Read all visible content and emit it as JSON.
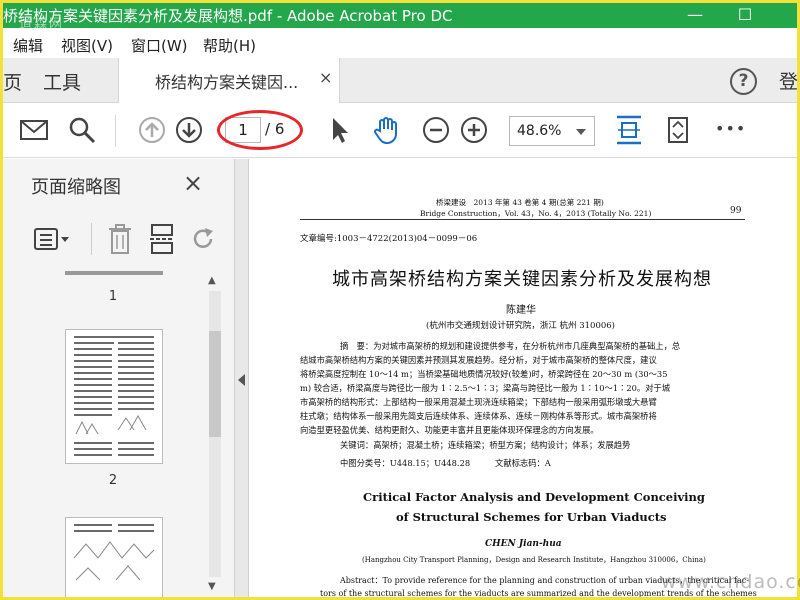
{
  "window": {
    "title": "桥结构方案关键因素分析及发展构想.pdf - Adobe Acrobat Pro DC",
    "watermark_left": "道森网",
    "minimize": "—",
    "maximize": "☐"
  },
  "menu": [
    "编辑",
    "视图(V)",
    "窗口(W)",
    "帮助(H)"
  ],
  "tabs": {
    "home_fragment": "页",
    "tools": "工具",
    "doc_tab": "桥结构方案关键因...",
    "close": "×",
    "help": "?",
    "signin_fragment": "登"
  },
  "toolbar": {
    "page_current": "1",
    "page_total": "/ 6",
    "zoom": "48.6%",
    "more": "•••"
  },
  "colors": {
    "titlebar": "#24a64a",
    "frame": "#f2e13a",
    "accent_blue": "#1a6fc2",
    "highlight_ring": "#e8262a"
  },
  "panel": {
    "title": "页面缩略图",
    "close": "×",
    "thumb_labels": [
      "1",
      "2"
    ]
  },
  "document": {
    "header_line1": "桥梁建设　2013 年第 43 卷第 4 期(总第 221 期)",
    "header_line2": "Bridge Construction，Vol. 43，No. 4，2013 (Totally No. 221)",
    "page_number": "99",
    "article_no": "文章编号:1003－4722(2013)04－0099－06",
    "title_cn": "城市高架桥结构方案关键因素分析及发展构想",
    "author_cn": "陈建华",
    "affiliation_cn": "(杭州市交通规划设计研究院，浙江 杭州 310006)",
    "abstract_lines": [
      "摘　要：为对城市高架桥的规划和建设提供参考，在分析杭州市几座典型高架桥的基础上，总",
      "结城市高架桥结构方案的关键因素并预测其发展趋势。经分析，对于城市高架桥的整体尺度，建议",
      "将桥梁高度控制在 10～14 m；当桥梁基础地质情况较好(较差)时，桥梁跨径在 20～30 m (30～35",
      "m) 较合适，桥梁高度与跨径比一般为 1∶2.5～1∶3；梁高与跨径比一般为 1∶10～1∶20。对于城",
      "市高架桥的结构形式：上部结构一般采用混凝土现浇连续箱梁；下部结构一般采用弧形墩或大悬臂",
      "柱式墩；结构体系一般采用先简支后连续体系、连续体系、连续－刚构体系等形式。城市高架桥将",
      "向造型更轻盈优美、结构更耐久、功能更丰富并且更能体现环保理念的方向发展。"
    ],
    "keywords": "关键词：高架桥；混凝土桥；连续箱梁；桥型方案；结构设计；体系；发展趋势",
    "classification": "中图分类号：U448.15；U448.28　　　文献标志码：A",
    "title_en_line1": "Critical Factor Analysis and Development Conceiving",
    "title_en_line2": "of Structural Schemes for Urban Viaducts",
    "author_en": "CHEN Jian-hua",
    "affiliation_en": "(Hangzhou City Transport Planning，Design and Research Institute，Hangzhou 310006，China)",
    "abstract_en_line1": "Abstract：To provide reference for the planning and construction of urban viaducts，the critical fac-",
    "abstract_en_line2": "tors of the structural schemes for the viaducts are summarized and the development trends of the schemes"
  },
  "site_watermark": "www.cndao.com"
}
